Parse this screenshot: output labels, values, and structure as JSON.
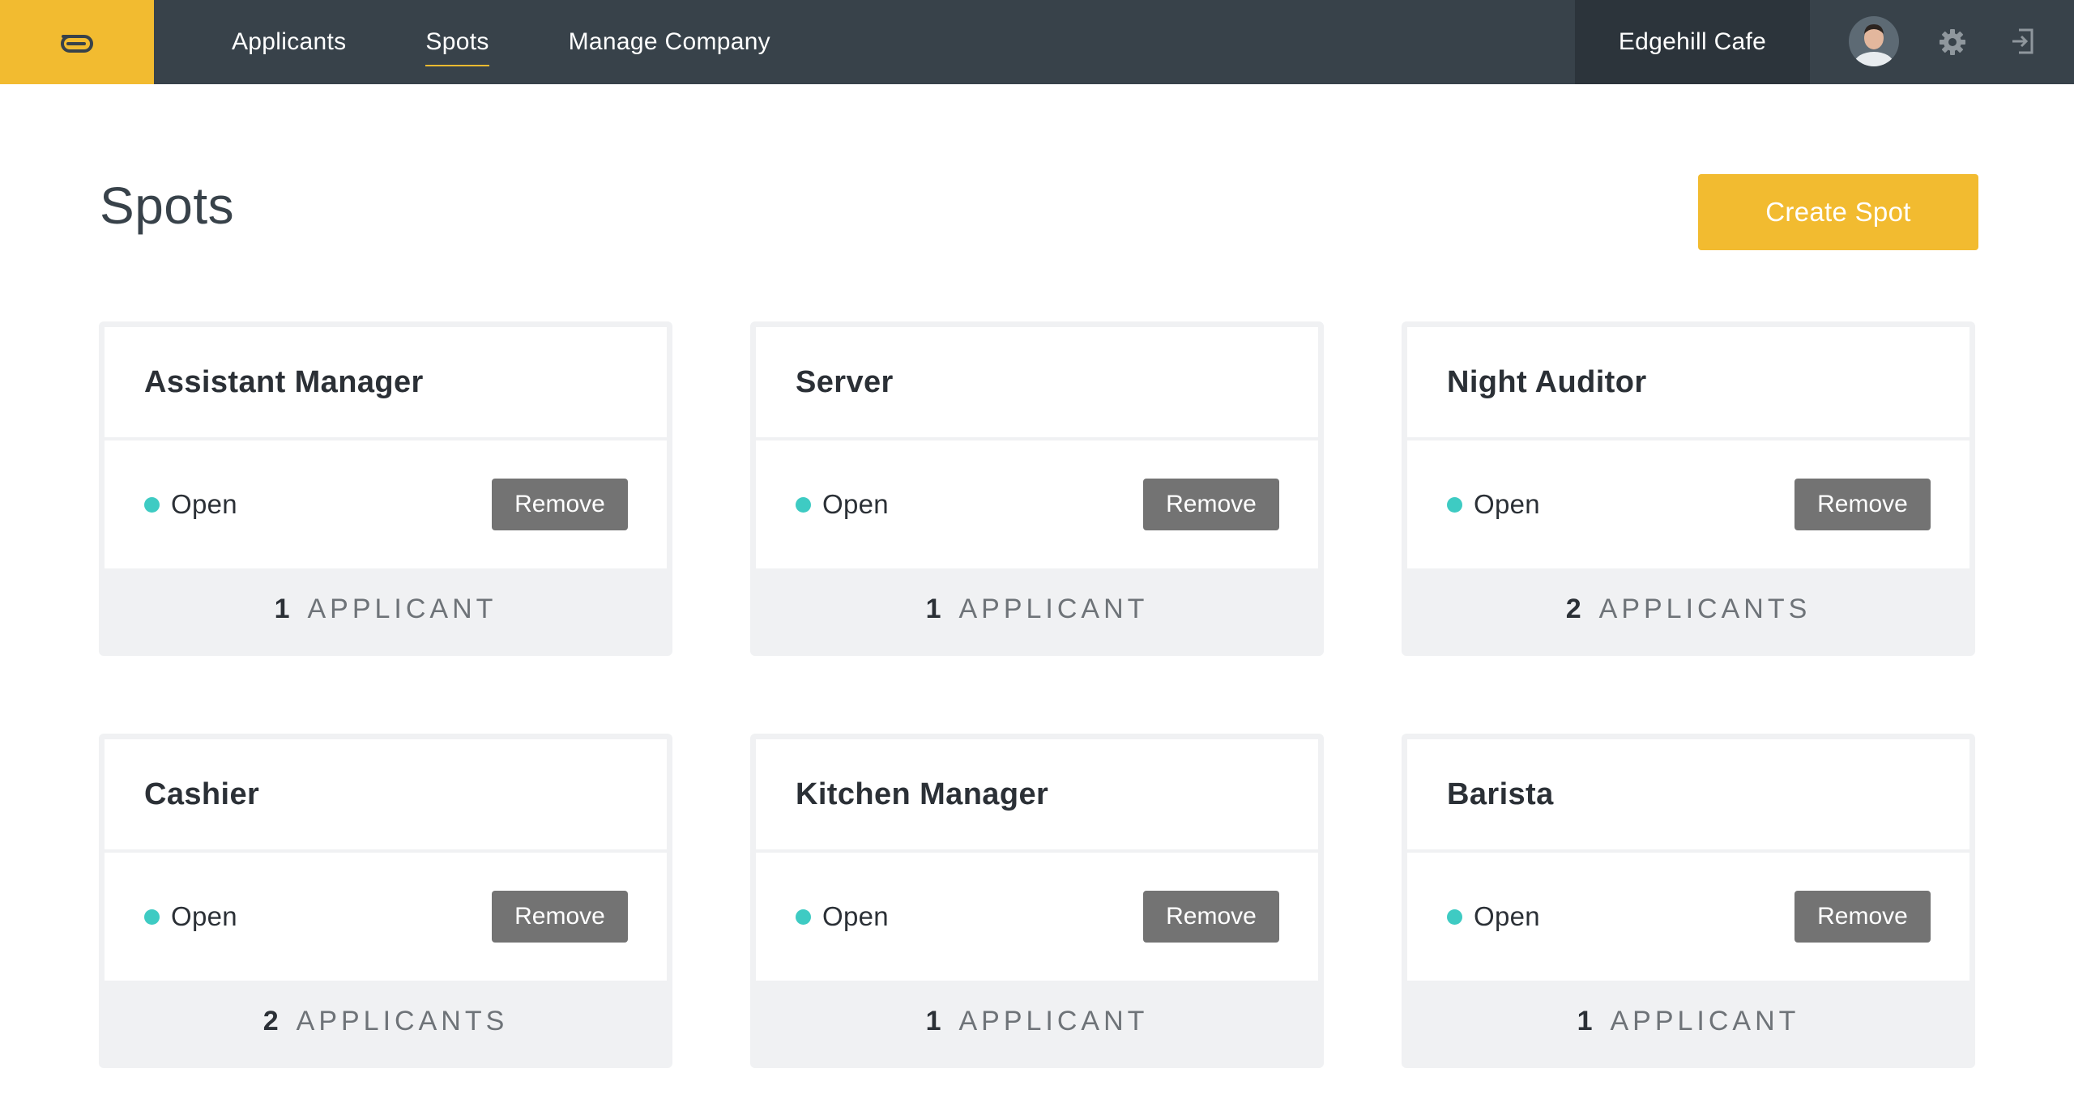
{
  "nav": {
    "links": [
      {
        "label": "Applicants",
        "active": false
      },
      {
        "label": "Spots",
        "active": true
      },
      {
        "label": "Manage Company",
        "active": false
      }
    ],
    "company": "Edgehill Cafe",
    "icons": [
      "logo-icon",
      "avatar",
      "gear-icon",
      "logout-icon"
    ]
  },
  "colors": {
    "brand": "#f2bb30",
    "nav_bg": "#38424a",
    "status_open": "#3ecbc3",
    "remove_button": "#737373"
  },
  "page": {
    "title": "Spots",
    "create_label": "Create Spot"
  },
  "spots": [
    {
      "title": "Assistant Manager",
      "status": "Open",
      "remove_label": "Remove",
      "count": "1",
      "count_label": "APPLICANT"
    },
    {
      "title": "Server",
      "status": "Open",
      "remove_label": "Remove",
      "count": "1",
      "count_label": "APPLICANT"
    },
    {
      "title": "Night Auditor",
      "status": "Open",
      "remove_label": "Remove",
      "count": "2",
      "count_label": "APPLICANTS"
    },
    {
      "title": "Cashier",
      "status": "Open",
      "remove_label": "Remove",
      "count": "2",
      "count_label": "APPLICANTS"
    },
    {
      "title": "Kitchen Manager",
      "status": "Open",
      "remove_label": "Remove",
      "count": "1",
      "count_label": "APPLICANT"
    },
    {
      "title": "Barista",
      "status": "Open",
      "remove_label": "Remove",
      "count": "1",
      "count_label": "APPLICANT"
    }
  ]
}
